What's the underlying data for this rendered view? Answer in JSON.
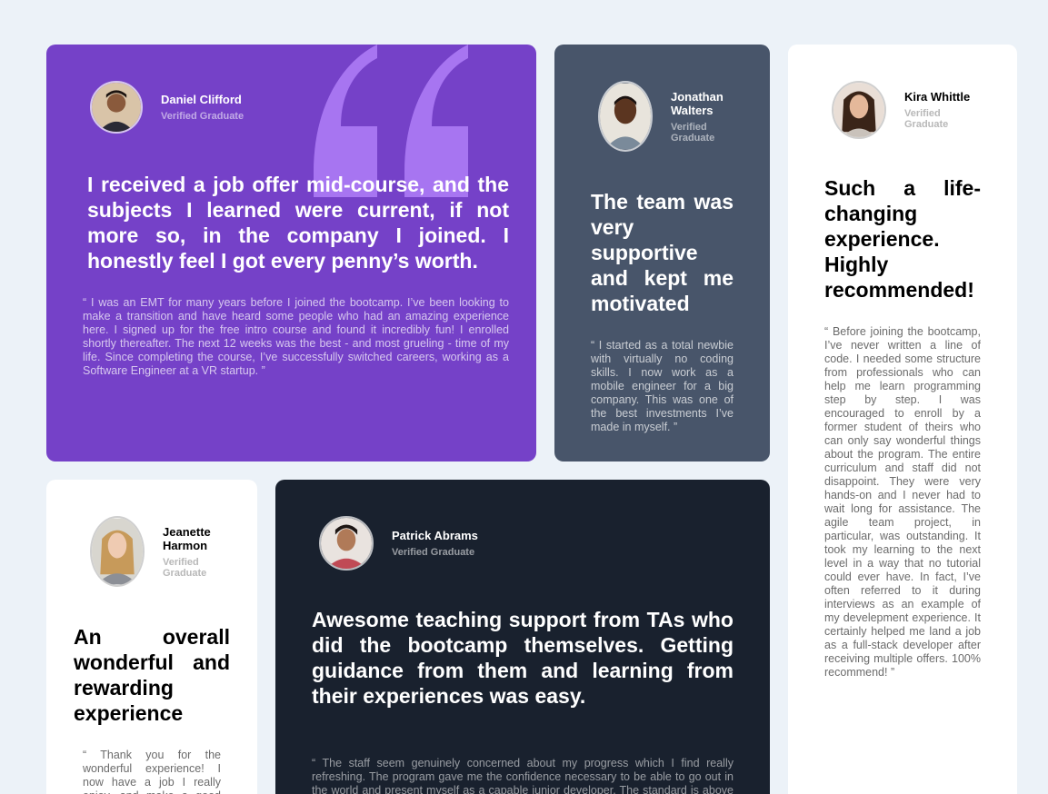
{
  "testimonials": {
    "daniel": {
      "name": "Daniel Clifford",
      "status": "Verified Graduate",
      "headline": "I received a job offer mid-course, and the subjects I learned were current, if not more so, in the company I joined. I honestly feel I got every penny’s worth.",
      "quote": "“ I was an EMT for many years before I joined the bootcamp. I’ve been looking to make a transition and have heard some people who had an amazing experience here. I signed up for the free intro course and found it incredibly fun! I enrolled shortly thereafter. The next 12 weeks was the best - and most grueling - time of my life. Since completing the course, I’ve successfully switched careers, working as a Software Engineer at a VR startup. ”"
    },
    "jonathan": {
      "name": "Jonathan Walters",
      "status": "Verified Graduate",
      "headline": "The team was very supportive and kept me motivated",
      "quote": "“ I started as a total newbie with virtually no coding skills. I now work as a mobile engineer for a big company. This was one of the best investments I’ve made in myself. ”"
    },
    "kira": {
      "name": "Kira Whittle",
      "status": "Verified Graduate",
      "headline": "Such a life-changing experience. Highly recommended!",
      "quote": "“ Before joining the bootcamp, I’ve never written a line of code. I needed some structure from professionals who can help me learn programming step by step. I was encouraged to enroll by a former student of theirs who can only say wonderful things about the program. The entire curriculum and staff did not disappoint. They were very hands-on and I never had to wait long for assistance. The agile team project, in particular, was outstanding. It took my learning to the next level in a way that no tutorial could ever have. In fact, I’ve often referred to it during interviews as an example of my develepment experience. It certainly helped me land a job as a full-stack developer after receiving multiple offers. 100% recommend! ”"
    },
    "jeanette": {
      "name": "Jeanette Harmon",
      "status": "Verified Graduate",
      "headline": "An overall wonderful and rewarding experience",
      "quote": "“ Thank you for the wonderful experience! I now have a job I really enjoy, and make a good living while doing something I love. ”"
    },
    "patrick": {
      "name": "Patrick Abrams",
      "status": "Verified Graduate",
      "headline": "Awesome teaching support from TAs who did the bootcamp themselves. Getting guidance from them and learning from their experiences was easy.",
      "quote": "“ The staff seem genuinely concerned about my progress which I find really refreshing. The program gave me the confidence necessary to be able to go out in the world and present myself as a capable junior developer. The standard is above the rest. You will get the personal attention you need from an incredible community of smart and amazing people. ”"
    }
  },
  "colors": {
    "background": "#ecf2f8",
    "purple": "#7541c8",
    "slate": "#48556a",
    "dark": "#19212e",
    "white": "#ffffff",
    "quote_mark": "#a775f1"
  }
}
